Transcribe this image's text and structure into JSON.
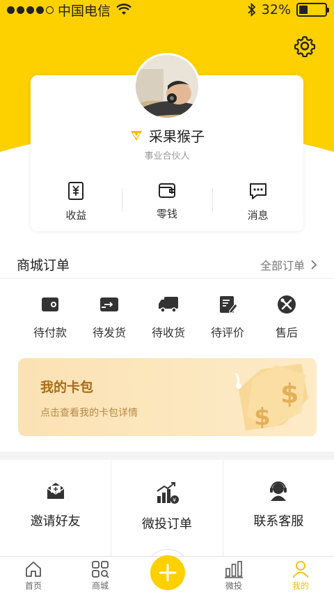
{
  "status_bar": {
    "carrier": "中国电信",
    "battery_text": "32%",
    "battery_level": 0.32,
    "signal_bars_filled": 4,
    "signal_bars_total": 5
  },
  "theme": {
    "accent": "#fdd000",
    "wallet_text": "#a96c14",
    "active_tab": "#f5bd00"
  },
  "profile": {
    "name": "采果猴子",
    "role": "事业合伙人",
    "badge_icon": "vip-badge-icon"
  },
  "quick_actions": [
    {
      "label": "收益",
      "icon": "yuan-receipt-icon"
    },
    {
      "label": "零钱",
      "icon": "wallet-icon"
    },
    {
      "label": "消息",
      "icon": "message-icon"
    }
  ],
  "orders": {
    "title": "商城订单",
    "all_link": "全部订单",
    "items": [
      {
        "label": "待付款",
        "icon": "wallet-pay-icon"
      },
      {
        "label": "待发货",
        "icon": "card-ship-icon"
      },
      {
        "label": "待收货",
        "icon": "truck-icon"
      },
      {
        "label": "待评价",
        "icon": "edit-doc-icon"
      },
      {
        "label": "售后",
        "icon": "tools-icon"
      }
    ]
  },
  "card_wallet": {
    "title": "我的卡包",
    "subtitle": "点击查看我的卡包详情"
  },
  "services": [
    {
      "label": "邀请好友",
      "icon": "invite-mail-icon"
    },
    {
      "label": "微投订单",
      "icon": "growth-chart-icon"
    },
    {
      "label": "联系客服",
      "icon": "customer-service-icon"
    }
  ],
  "tabs": [
    {
      "label": "首页",
      "icon": "home-icon",
      "active": false
    },
    {
      "label": "商城",
      "icon": "shop-grid-icon",
      "active": false
    },
    {
      "label": "",
      "icon": "plus-icon",
      "active": false
    },
    {
      "label": "微投",
      "icon": "bar-chart-icon",
      "active": false
    },
    {
      "label": "我的",
      "icon": "user-icon",
      "active": true
    }
  ]
}
